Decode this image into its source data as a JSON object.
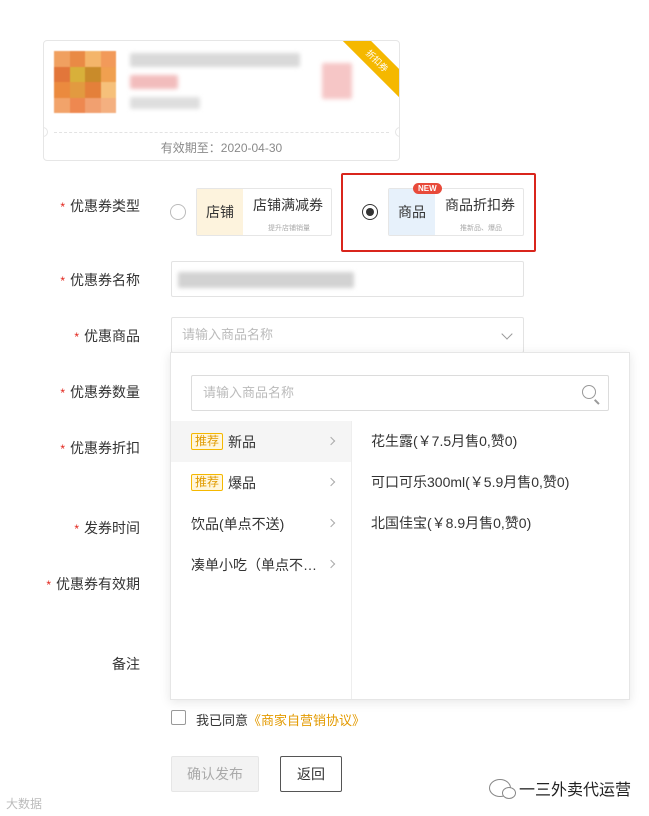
{
  "coupon_preview": {
    "ribbon_label": "折扣券",
    "validity": "有效期至：2020-04-30"
  },
  "form": {
    "coupon_type": {
      "label": "优惠券类型",
      "options": [
        {
          "tag": "店铺",
          "title": "店铺满减券",
          "sub": "提升店铺销量",
          "selected": false
        },
        {
          "tag": "商品",
          "title": "商品折扣券",
          "sub": "推新品、爆品",
          "selected": true,
          "badge": "NEW"
        }
      ]
    },
    "coupon_name": {
      "label": "优惠券名称"
    },
    "coupon_goods": {
      "label": "优惠商品",
      "placeholder": "请输入商品名称"
    },
    "coupon_quantity": {
      "label": "优惠券数量"
    },
    "coupon_discount": {
      "label": "优惠券折扣"
    },
    "issue_time": {
      "label": "发券时间"
    },
    "coupon_validity": {
      "label": "优惠券有效期"
    },
    "remark": {
      "label": "备注"
    }
  },
  "dropdown": {
    "search_placeholder": "请输入商品名称",
    "categories": [
      {
        "tag": "推荐",
        "label": "新品"
      },
      {
        "tag": "推荐",
        "label": "爆品"
      },
      {
        "tag": "",
        "label": "饮品(单点不送)"
      },
      {
        "tag": "",
        "label": "凑单小吃（单点不…"
      }
    ],
    "items": [
      "花生露(￥7.5月售0,赞0)",
      "可口可乐300ml(￥5.9月售0,赞0)",
      "北国佳宝(￥8.9月售0,赞0)"
    ]
  },
  "agreement": {
    "prefix": "我已同意",
    "link": "《商家自营销协议》"
  },
  "buttons": {
    "confirm": "确认发布",
    "back": "返回"
  },
  "watermarks": {
    "left": "大数据",
    "right": "一三外卖代运营"
  },
  "colors": {
    "required_star": "#e2231a",
    "highlight_border": "#d9251c",
    "tag_yellow": "#f5b800",
    "new_badge": "#e84a3a"
  }
}
